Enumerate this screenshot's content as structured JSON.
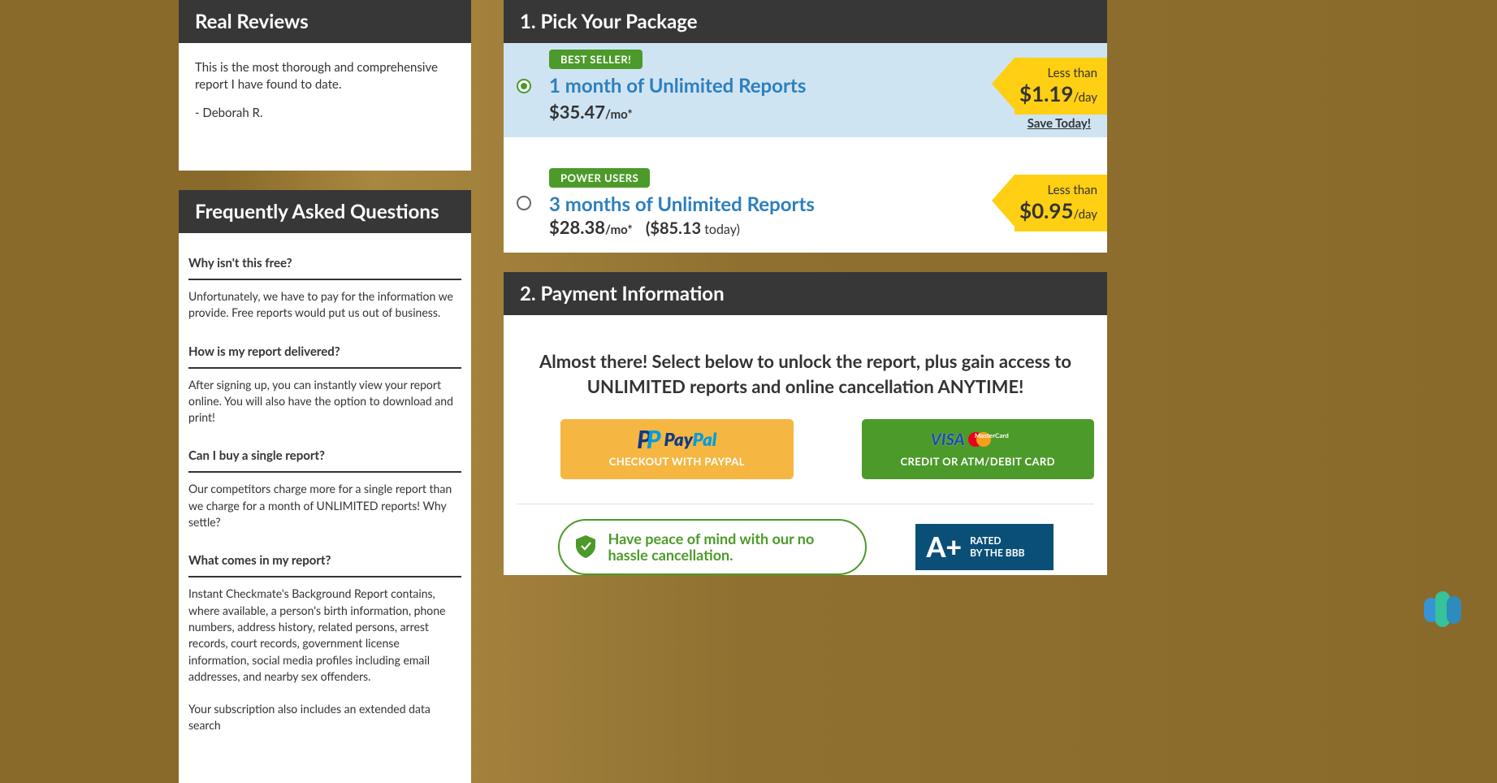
{
  "sidebar": {
    "reviews": {
      "header": "Real Reviews",
      "text": "This is the most thorough and comprehensive report I have found to date.",
      "author": "- Deborah R."
    },
    "faq": {
      "header": "Frequently Asked Questions",
      "items": [
        {
          "q": "Why isn't this free?",
          "a": "Unfortunately, we have to pay for the information we provide. Free reports would put us out of business."
        },
        {
          "q": "How is my report delivered?",
          "a": "After signing up, you can instantly view your report online. You will also have the option to download and print!"
        },
        {
          "q": "Can I buy a single report?",
          "a": "Our competitors charge more for a single report than we charge for a month of UNLIMITED reports! Why settle?"
        },
        {
          "q": "What comes in my report?",
          "a": "Instant Checkmate's Background Report contains, where available, a person's birth information, phone numbers, address history, related persons, arrest records, court records, government license information, social media profiles including email addresses, and nearby sex offenders."
        }
      ],
      "trailing": "Your subscription also includes an extended data search"
    }
  },
  "package": {
    "header": "1. Pick Your Package",
    "options": [
      {
        "badge": "BEST SELLER!",
        "title": "1 month of Unlimited Reports",
        "price": "$35.47",
        "per": "/mo*",
        "today_amount": "",
        "today_label": "",
        "less_than": "Less than",
        "day_amount": "$1.19",
        "day_label": "/day",
        "selected": true
      },
      {
        "badge": "POWER USERS",
        "title": "3 months of Unlimited Reports",
        "price": "$28.38",
        "per": "/mo*",
        "today_amount": "($85.13",
        "today_label": " today)",
        "less_than": "Less than",
        "day_amount": "$0.95",
        "day_label": "/day",
        "selected": false
      }
    ],
    "save_today": "Save Today!"
  },
  "payment": {
    "header": "2. Payment Information",
    "almost": "Almost there! Select below to unlock the report, plus gain access to UNLIMITED reports and online cancellation ANYTIME!",
    "paypal_label": "CHECKOUT WITH PAYPAL",
    "card_label": "CREDIT OR ATM/DEBIT CARD",
    "paypal_brand_pay": "Pay",
    "paypal_brand_pal": "Pal",
    "visa_brand": "VISA",
    "mc_brand": "MasterCard"
  },
  "footer": {
    "peace": "Have peace of mind with our no hassle cancellation.",
    "bbb_grade": "A+",
    "bbb_line1": "RATED",
    "bbb_line2": "BY THE BBB"
  }
}
